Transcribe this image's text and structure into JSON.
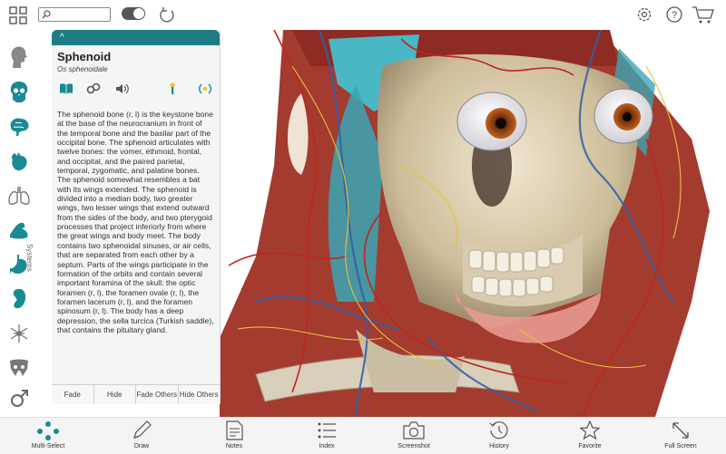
{
  "colors": {
    "accent": "#1d7c83",
    "sidebar_icon": "#1a8a94",
    "bottom_accent": "#1a8a94"
  },
  "toolbar": {
    "left_icons": [
      "grid-icon",
      "search-icon",
      "toggle-switch",
      "refresh-icon"
    ],
    "right_icons": [
      "gear-icon",
      "help-icon",
      "cart-icon"
    ],
    "search_placeholder": ""
  },
  "sidebar": {
    "label": "Systems",
    "items": [
      {
        "name": "head-silhouette-icon"
      },
      {
        "name": "skull-icon"
      },
      {
        "name": "brain-icon"
      },
      {
        "name": "heart-icon"
      },
      {
        "name": "lungs-icon"
      },
      {
        "name": "muscle-icon"
      },
      {
        "name": "stomach-icon"
      },
      {
        "name": "kidney-icon"
      },
      {
        "name": "nerve-icon"
      },
      {
        "name": "pelvis-icon"
      },
      {
        "name": "male-symbol-icon"
      }
    ]
  },
  "panel": {
    "collapse_glyph": "^",
    "title": "Sphenoid",
    "subtitle": "Os sphenoidale",
    "tools": [
      "book-icon",
      "link-icon",
      "audio-icon",
      "pin-icon",
      "radio-icon"
    ],
    "description": "The sphenoid bone (r, l) is the keystone bone at the base of the neurocranium in front of the temporal bone and the basilar part of the occipital bone. The sphenoid articulates with twelve bones: the vomer, ethmoid, frontal, and occipital, and the paired parietal, temporal, zygomatic, and palatine bones. The sphenoid somewhat resembles a bat with its wings extended. The sphenoid is divided into a median body, two greater wings, two lesser wings that extend outward from the sides of the body, and two pterygoid processes that project inferiorly from where the great wings and body meet. The body contains two sphenoidal sinuses, or air cells, that are separated from each other by a septum. Parts of the wings participate in the formation of the orbits and contain several important foramina of the skull: the optic foramen (r, l), the foramen ovale (r, l), the foramen lacerum (r, l), and the foramen spinosum (r, l). The body has a deep depression, the sella turcica (Turkish saddle), that contains the pituitary gland.",
    "buttons": [
      {
        "label": "Fade"
      },
      {
        "label": "Hide"
      },
      {
        "label": "Fade Others"
      },
      {
        "label": "Hide Others"
      }
    ]
  },
  "bottom": {
    "items": [
      {
        "label": "Multi-Select",
        "icon": "multi-select-icon"
      },
      {
        "label": "Draw",
        "icon": "pencil-icon"
      },
      {
        "label": "Notes",
        "icon": "notes-icon"
      },
      {
        "label": "Index",
        "icon": "list-icon"
      },
      {
        "label": "Screenshot",
        "icon": "camera-icon"
      },
      {
        "label": "History",
        "icon": "history-icon"
      },
      {
        "label": "Favorite",
        "icon": "star-icon"
      },
      {
        "label": "Full Screen",
        "icon": "expand-icon"
      }
    ]
  }
}
